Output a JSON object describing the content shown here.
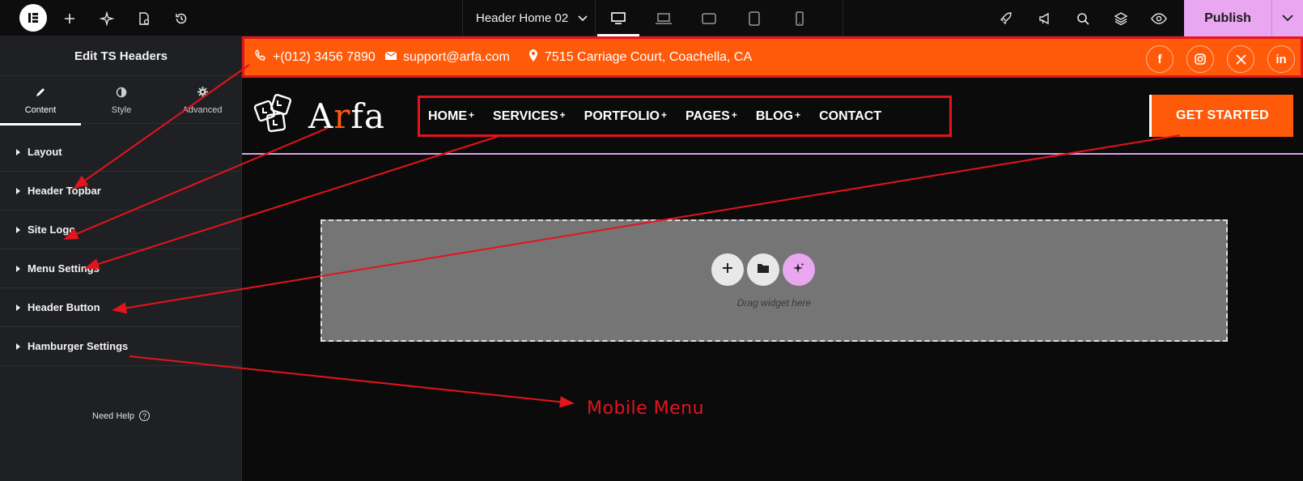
{
  "topbar": {
    "document_title": "Header Home 02",
    "publish_label": "Publish",
    "icons": [
      "elementor-logo-icon",
      "add-icon",
      "ai-sparkle-icon",
      "page-settings-icon",
      "history-icon",
      "rocket-icon",
      "megaphone-icon",
      "search-icon",
      "layers-icon",
      "preview-eye-icon"
    ],
    "devices": [
      "desktop",
      "laptop",
      "tablet-landscape",
      "tablet-portrait",
      "mobile"
    ],
    "active_device": "desktop"
  },
  "sidebar": {
    "title": "Edit TS Headers",
    "tabs": [
      {
        "label": "Content",
        "icon": "pencil-icon"
      },
      {
        "label": "Style",
        "icon": "half-circle-icon"
      },
      {
        "label": "Advanced",
        "icon": "gear-icon"
      }
    ],
    "sections": [
      {
        "label": "Layout"
      },
      {
        "label": "Header Topbar"
      },
      {
        "label": "Site Logo"
      },
      {
        "label": "Menu Settings"
      },
      {
        "label": "Header Button"
      },
      {
        "label": "Hamburger Settings"
      }
    ],
    "help": "Need Help"
  },
  "canvas": {
    "topbar": {
      "phone": "+(012) 3456 7890",
      "email": "support@arfa.com",
      "address": "7515 Carriage Court, Coachella, CA",
      "socials": [
        "facebook-icon",
        "instagram-icon",
        "x-twitter-icon",
        "linkedin-icon"
      ]
    },
    "brand": {
      "first": "A",
      "accent": "r",
      "rest": "fa"
    },
    "nav": [
      {
        "label": "HOME",
        "plus": "+"
      },
      {
        "label": "SERVICES",
        "plus": "+"
      },
      {
        "label": "PORTFOLIO",
        "plus": "+"
      },
      {
        "label": "PAGES",
        "plus": "+"
      },
      {
        "label": "BLOG",
        "plus": "+"
      },
      {
        "label": "CONTACT",
        "plus": ""
      }
    ],
    "cta_label": "GET STARTED",
    "dropzone_text": "Drag widget here",
    "annotation": "Mobile Menu"
  },
  "colors": {
    "accent_orange": "#ff5a0a",
    "annotation_red": "#e3141c",
    "publish_pink": "#e9a6f1"
  }
}
